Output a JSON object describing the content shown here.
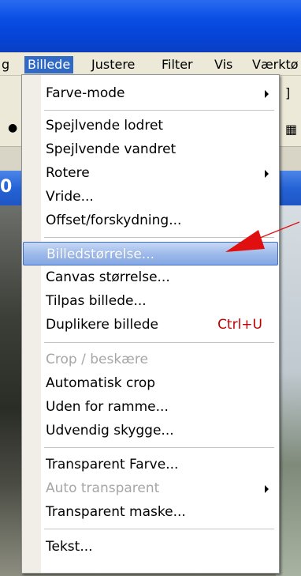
{
  "menubar": {
    "items": [
      {
        "label": "g"
      },
      {
        "label": "Billede"
      },
      {
        "label": "Justere"
      },
      {
        "label": "Filter"
      },
      {
        "label": "Vis"
      },
      {
        "label": "Værktø"
      }
    ]
  },
  "document": {
    "title_fragment": "0"
  },
  "menu": {
    "items": [
      {
        "label": "Farve-mode"
      },
      {
        "label": "Spejlvende lodret"
      },
      {
        "label": "Spejlvende vandret"
      },
      {
        "label": "Rotere"
      },
      {
        "label": "Vride..."
      },
      {
        "label": "Offset/forskydning..."
      },
      {
        "label": "Billedstørrelse..."
      },
      {
        "label": "Canvas størrelse..."
      },
      {
        "label": "Tilpas billede..."
      },
      {
        "label": "Duplikere billede",
        "shortcut": "Ctrl+U"
      },
      {
        "label": "Crop / beskære"
      },
      {
        "label": "Automatisk crop"
      },
      {
        "label": "Uden for ramme..."
      },
      {
        "label": "Udvendig skygge..."
      },
      {
        "label": "Transparent Farve..."
      },
      {
        "label": "Auto transparent"
      },
      {
        "label": "Transparent maske..."
      },
      {
        "label": "Tekst..."
      }
    ]
  },
  "colors": {
    "selection": "#316ac5",
    "annotation_arrow": "#e01010",
    "shortcut_text": "#c00000"
  }
}
